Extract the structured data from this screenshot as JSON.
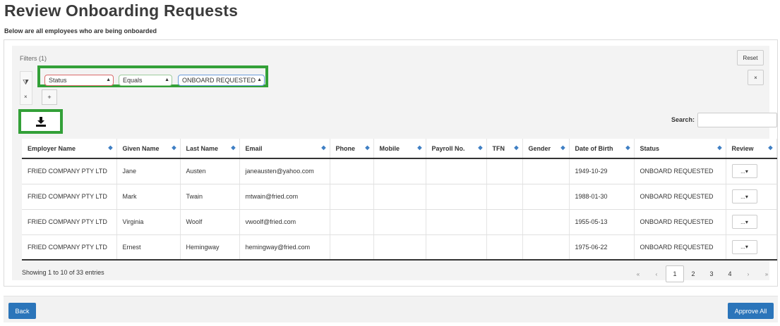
{
  "page": {
    "title": "Review Onboarding Requests",
    "subtitle": "Below are all employees who are being onboarded"
  },
  "filters": {
    "label": "Filters (1)",
    "reset_label": "Reset",
    "remove_label": "×",
    "add_label": "+",
    "field": "Status",
    "operator": "Equals",
    "value": "ONBOARD REQUESTED",
    "funnel_label": "⧩",
    "clear_label": "×"
  },
  "search": {
    "label": "Search:",
    "value": ""
  },
  "table": {
    "columns": [
      "Employer Name",
      "Given Name",
      "Last Name",
      "Email",
      "Phone",
      "Mobile",
      "Payroll No.",
      "TFN",
      "Gender",
      "Date of Birth",
      "Status",
      "Review"
    ],
    "rows": [
      [
        "FRIED COMPANY PTY LTD",
        "Jane",
        "Austen",
        "janeausten@yahoo.com",
        "",
        "",
        "",
        "",
        "",
        "1949-10-29",
        "ONBOARD REQUESTED",
        "..."
      ],
      [
        "FRIED COMPANY PTY LTD",
        "Mark",
        "Twain",
        "mtwain@fried.com",
        "",
        "",
        "",
        "",
        "",
        "1988-01-30",
        "ONBOARD REQUESTED",
        "..."
      ],
      [
        "FRIED COMPANY PTY LTD",
        "Virginia",
        "Woolf",
        "vwoolf@fried.com",
        "",
        "",
        "",
        "",
        "",
        "1955-05-13",
        "ONBOARD REQUESTED",
        "..."
      ],
      [
        "FRIED COMPANY PTY LTD",
        "Ernest",
        "Hemingway",
        "hemingway@fried.com",
        "",
        "",
        "",
        "",
        "",
        "1975-06-22",
        "ONBOARD REQUESTED",
        "..."
      ]
    ]
  },
  "info": "Showing 1 to 10 of 33 entries",
  "pagination": {
    "first": "«",
    "prev": "‹",
    "pages": [
      "1",
      "2",
      "3",
      "4"
    ],
    "next": "›",
    "last": "»",
    "current": "1"
  },
  "footer": {
    "back_label": "Back",
    "approve_label": "Approve All"
  },
  "colors": {
    "primary": "#2b75ba",
    "highlight": "#33a038"
  }
}
